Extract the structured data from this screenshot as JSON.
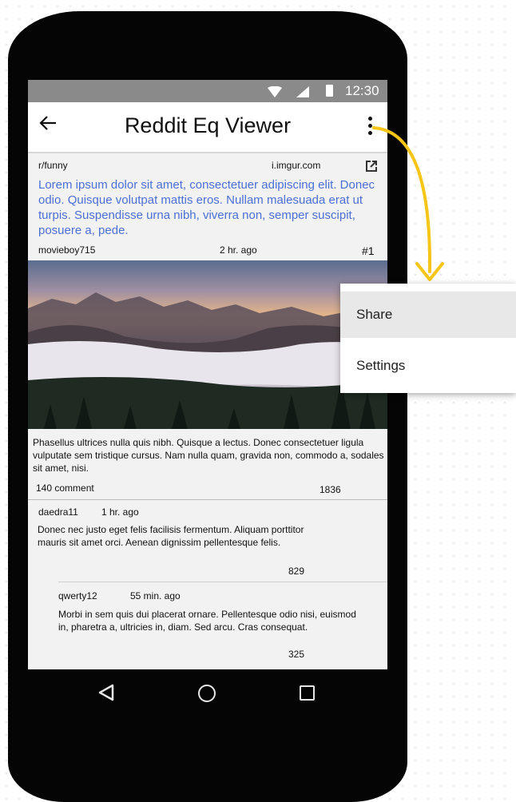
{
  "status_bar": {
    "time": "12:30"
  },
  "app_bar": {
    "title": "Reddit Eq Viewer"
  },
  "post": {
    "subreddit": "r/funny",
    "domain": "i.imgur.com",
    "title": "Lorem ipsum dolor sit amet, consectetuer adipiscing elit. Donec odio. Quisque volutpat mattis eros. Nullam malesuada erat ut turpis. Suspendisse urna nibh, viverra non, semper suscipit, posuere a, pede.",
    "author": "movieboy715",
    "time": "2 hr. ago",
    "rank": "#1",
    "body": "Phasellus ultrices nulla quis nibh. Quisque a lectus. Donec consectetuer ligula vulputate sem tristique cursus. Nam nulla quam, gravida non, commodo a, sodales sit amet, nisi.",
    "comments": "140 comment",
    "score": "1836"
  },
  "comments": [
    {
      "author": "daedra11",
      "time": "1 hr. ago",
      "body": "Donec nec justo eget felis facilisis fermentum. Aliquam porttitor mauris sit amet orci. Aenean dignissim pellentesque felis.",
      "score": "829"
    },
    {
      "author": "qwerty12",
      "time": "55 min. ago",
      "body": "Morbi in sem quis dui placerat ornare. Pellentesque odio nisi, euismod in, pharetra a, ultricies in, diam. Sed arcu. Cras consequat.",
      "score": "325"
    }
  ],
  "menu": {
    "items": [
      {
        "label": "Share"
      },
      {
        "label": "Settings"
      }
    ]
  },
  "colors": {
    "link_blue": "#4b6fd6",
    "status_bar": "#8a8a8a",
    "arrow": "#f5c518"
  },
  "icons": [
    "wifi-icon",
    "signal-icon",
    "battery-icon",
    "back-arrow-icon",
    "overflow-menu-icon",
    "external-link-icon",
    "nav-back-icon",
    "nav-home-icon",
    "nav-recents-icon"
  ]
}
